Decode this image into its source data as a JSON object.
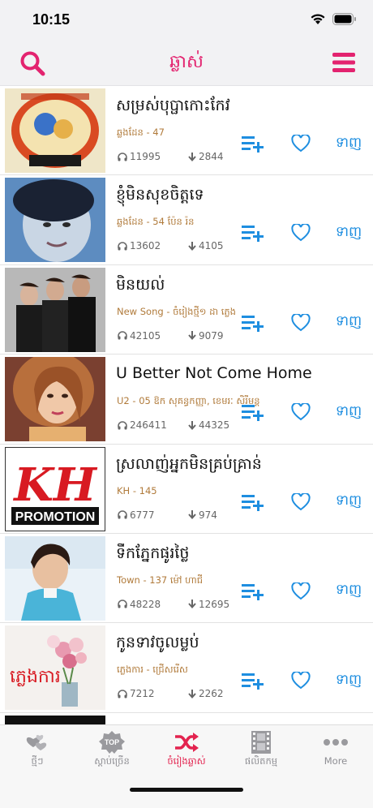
{
  "status_bar": {
    "time": "10:15"
  },
  "header": {
    "title": "ឆ្លាស់"
  },
  "songs": [
    {
      "title": "សម្រស់បុប្ផាកោះកែវ",
      "meta": "ឆ្លងដែន -  47",
      "listens": "11995",
      "downloads": "2844",
      "download_label": "ទាញ"
    },
    {
      "title": "ខ្ញុំមិនសុខចិត្តទេ",
      "meta": "ឆ្លងដែន -  54  ប៉ែន រ៉ន",
      "listens": "13602",
      "downloads": "4105",
      "download_label": "ទាញ"
    },
    {
      "title": "មិនយល់",
      "meta": "New Song -  ចំរៀងថ្មី១  ដា ភ្លេង",
      "listens": "42105",
      "downloads": "9079",
      "download_label": "ទាញ"
    },
    {
      "title": "U Better Not Come Home",
      "meta": "U2 -  05  ឱក សុគន្ធកញ្ញា, ខេមរៈ សិរីមន្ត",
      "listens": "246411",
      "downloads": "44325",
      "download_label": "ទាញ"
    },
    {
      "title": "ស្រលាញ់អ្នកមិនគ្រប់គ្រាន់",
      "meta": "KH -  145",
      "listens": "6777",
      "downloads": "974",
      "download_label": "ទាញ"
    },
    {
      "title": "ទឹកភ្នែកផូរថ្លៃ",
      "meta": "Town -  137  ម៉ៅ ហាជី",
      "listens": "48228",
      "downloads": "12695",
      "download_label": "ទាញ"
    },
    {
      "title": "កូនទាវចូលម្លប់",
      "meta": "ភ្លេងការ -  ជ្រើសរើស",
      "listens": "7212",
      "downloads": "2262",
      "download_label": "ទាញ"
    }
  ],
  "thumbnails": {
    "kh_logo_text": "KH",
    "kh_promo_text": "PROMOTION",
    "wedding_text": "ភ្លេងការ"
  },
  "tabs": [
    {
      "label": "ថ្មីៗ",
      "icon": "hearts-icon",
      "active": false
    },
    {
      "label": "ស្តាប់ច្រើន",
      "icon": "top-badge-icon",
      "active": false,
      "badge": "TOP"
    },
    {
      "label": "ចំរៀងឆ្លាស់",
      "icon": "shuffle-icon",
      "active": true
    },
    {
      "label": "ផលិតកម្ម",
      "icon": "film-icon",
      "active": false
    },
    {
      "label": "More",
      "icon": "more-dots-icon",
      "active": false
    }
  ],
  "colors": {
    "accent": "#e3236f",
    "action_blue": "#1e8ee0",
    "meta_brown": "#b07a3a",
    "active_tab": "#e3234f"
  }
}
